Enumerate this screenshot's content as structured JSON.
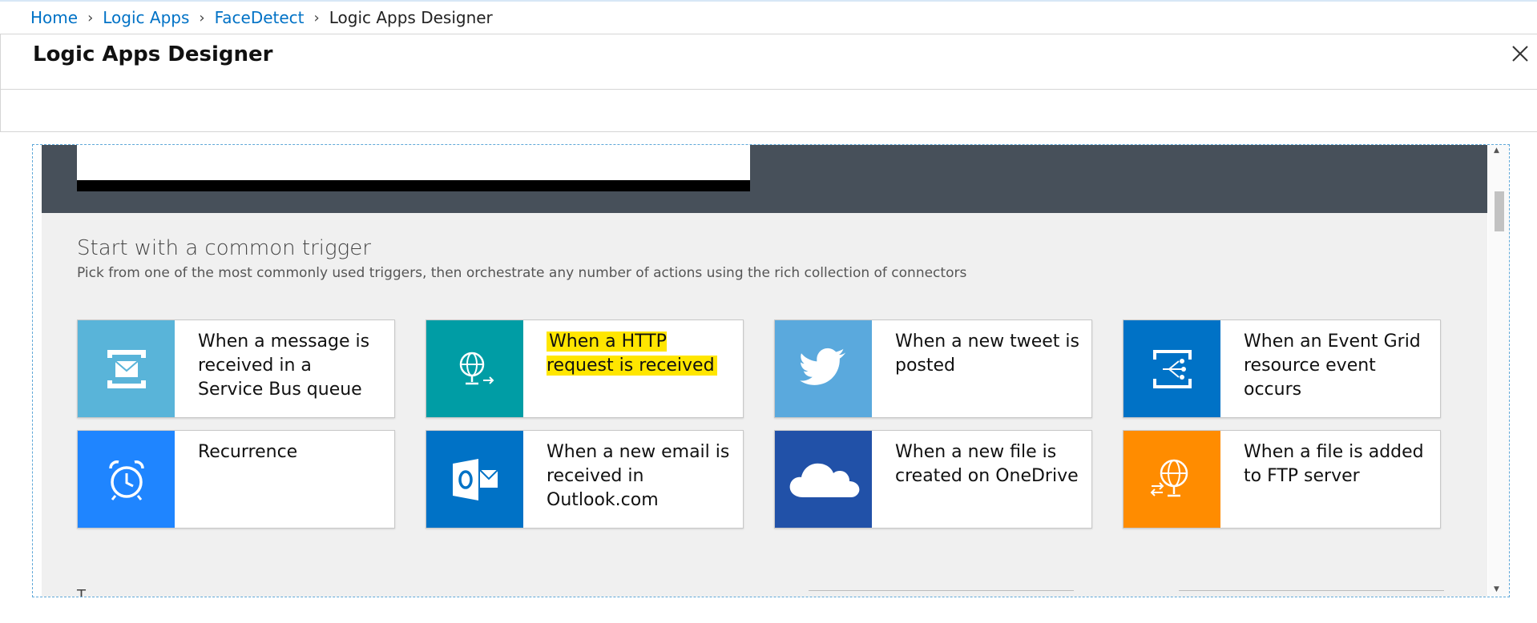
{
  "breadcrumb": {
    "items": [
      "Home",
      "Logic Apps",
      "FaceDetect"
    ],
    "current": "Logic Apps Designer"
  },
  "blade": {
    "title": "Logic Apps Designer"
  },
  "triggers": {
    "title": "Start with a common trigger",
    "subtitle": "Pick from one of the most commonly used triggers, then orchestrate any number of actions using the rich collection of connectors",
    "cards": [
      {
        "label": "When a message is received in a Service Bus queue",
        "icon": "service-bus-icon",
        "color": "#59b4d9"
      },
      {
        "label": "When a HTTP request is received",
        "icon": "http-request-icon",
        "color": "#009da5",
        "highlight": true
      },
      {
        "label": "When a new tweet is posted",
        "icon": "twitter-icon",
        "color": "#5aa9dd"
      },
      {
        "label": "When an Event Grid resource event occurs",
        "icon": "event-grid-icon",
        "color": "#0072c6"
      },
      {
        "label": "Recurrence",
        "icon": "alarm-clock-icon",
        "color": "#1f85ff"
      },
      {
        "label": "When a new email is received in Outlook.com",
        "icon": "outlook-icon",
        "color": "#0072c6"
      },
      {
        "label": "When a new file is created on OneDrive",
        "icon": "onedrive-icon",
        "color": "#2151a8"
      },
      {
        "label": "When a file is added to FTP server",
        "icon": "ftp-icon",
        "color": "#ff8c00"
      }
    ]
  },
  "bottom": {
    "hint": "T"
  }
}
